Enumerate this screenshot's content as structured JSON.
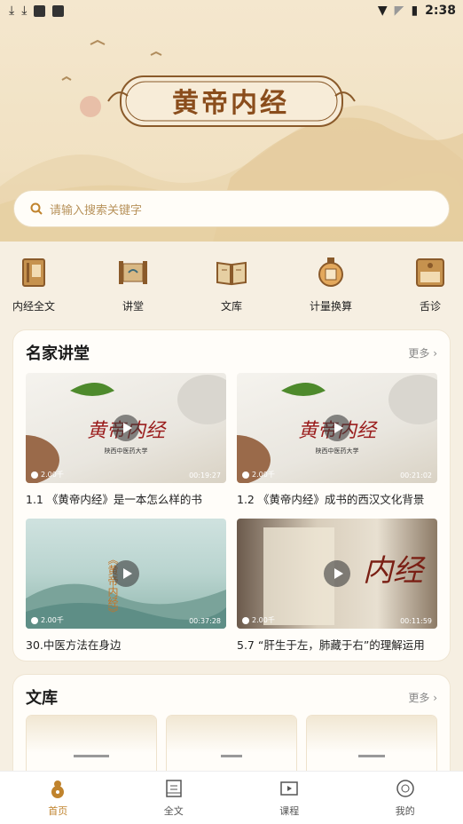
{
  "status_bar": {
    "time": "2:38"
  },
  "hero": {
    "title": "黄帝内经"
  },
  "search": {
    "placeholder": "请输入搜索关键字"
  },
  "menu": [
    {
      "label": "内经全文",
      "icon": "book-icon"
    },
    {
      "label": "讲堂",
      "icon": "scroll-icon"
    },
    {
      "label": "文库",
      "icon": "open-book-icon"
    },
    {
      "label": "计量换算",
      "icon": "scale-jar-icon"
    },
    {
      "label": "舌诊",
      "icon": "tongue-box-icon"
    }
  ],
  "lectures": {
    "title": "名家讲堂",
    "more": "更多",
    "videos": [
      {
        "title": "1.1 《黄帝内经》是一本怎么样的书",
        "views": "2.00千",
        "duration": "00:19:27",
        "thumb_text": "黄帝内经",
        "thumb_sub": "陕西中医药大学"
      },
      {
        "title": "1.2 《黄帝内经》成书的西汉文化背景",
        "views": "2.00千",
        "duration": "00:21:02",
        "thumb_text": "黄帝内经",
        "thumb_sub": "陕西中医药大学"
      },
      {
        "title": "30.中医方法在身边",
        "views": "2.00千",
        "duration": "00:37:28",
        "thumb_text": "《黄帝内经》"
      },
      {
        "title": "5.7 “肝生于左，肺藏于右”的理解运用",
        "views": "2.00千",
        "duration": "00:11:59",
        "thumb_text": "内经"
      }
    ]
  },
  "library": {
    "title": "文库",
    "more": "更多"
  },
  "tabbar": [
    {
      "label": "首页",
      "icon": "gourd-icon",
      "active": true
    },
    {
      "label": "全文",
      "icon": "document-icon",
      "active": false
    },
    {
      "label": "课程",
      "icon": "video-play-icon",
      "active": false
    },
    {
      "label": "我的",
      "icon": "profile-icon",
      "active": false
    }
  ],
  "colors": {
    "accent": "#c0832d",
    "title_brown": "#8a4d1c",
    "background": "#f6efe2"
  }
}
